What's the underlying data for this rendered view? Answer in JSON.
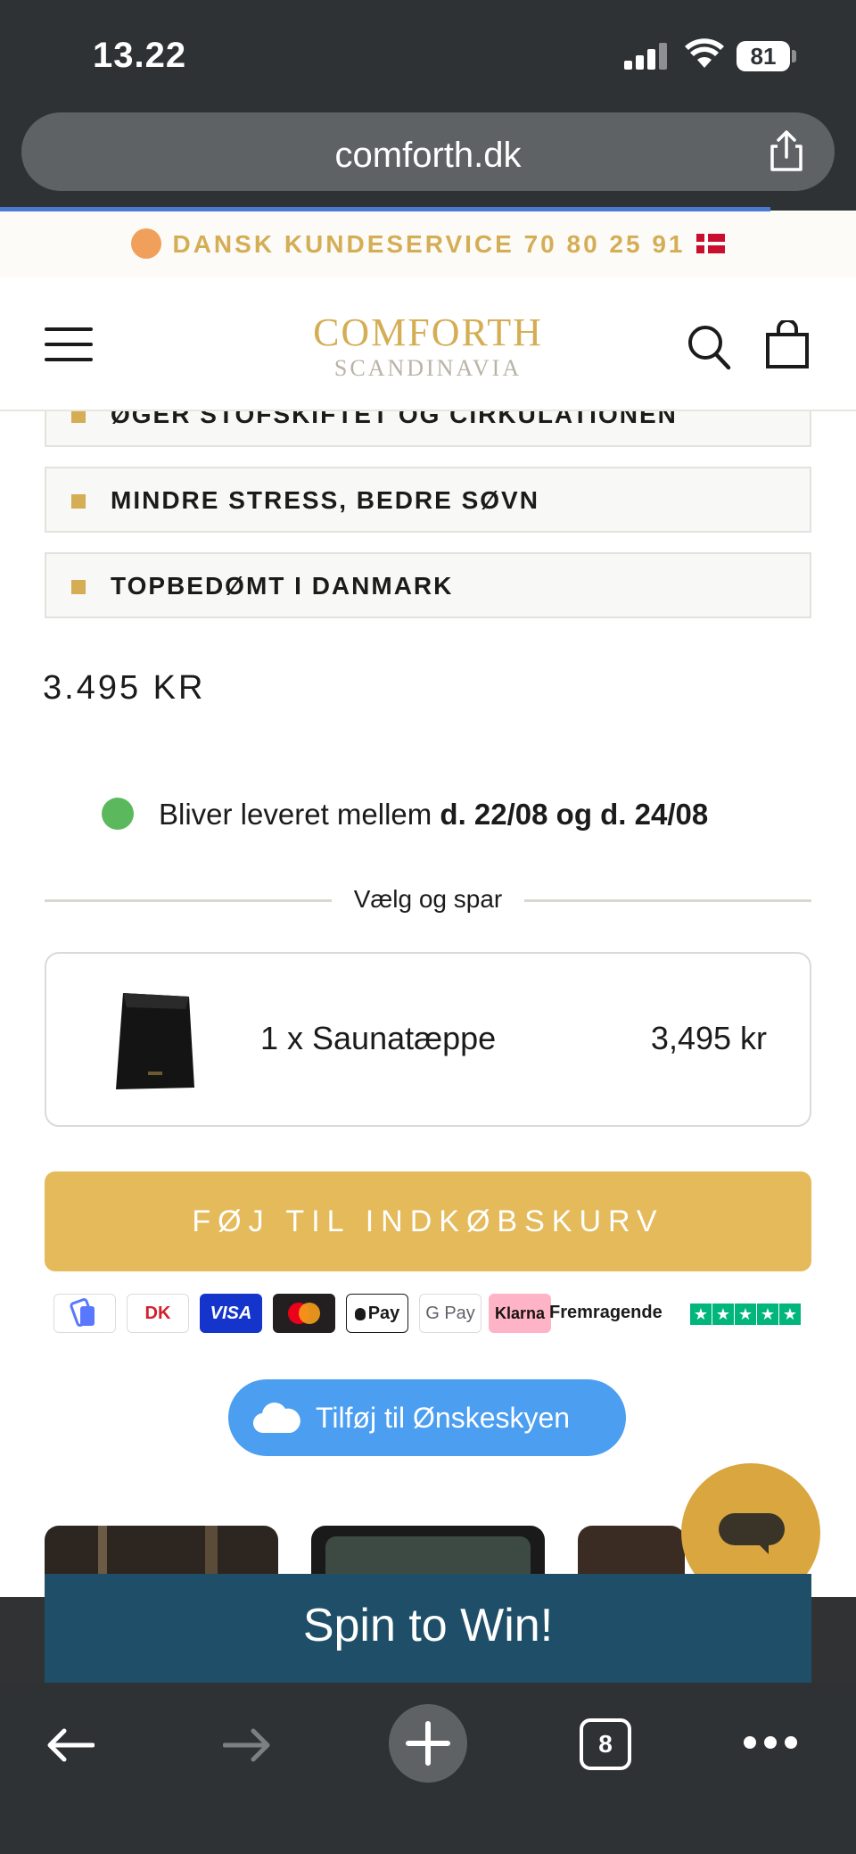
{
  "status_bar": {
    "time": "13.22",
    "battery": "81"
  },
  "browser": {
    "url": "comforth.dk",
    "tab_count": "8",
    "load_progress": 0.9
  },
  "announcement": {
    "text": "DANSK KUNDESERVICE 70 80 25 91"
  },
  "header": {
    "logo_main": "COMFORTH",
    "logo_sub": "SCANDINAVIA"
  },
  "benefits": [
    {
      "label": "ØGER STOFSKIFTET OG CIRKULATIONEN"
    },
    {
      "label": "MINDRE STRESS, BEDRE SØVN"
    },
    {
      "label": "TOPBEDØMT I DANMARK"
    }
  ],
  "product": {
    "price": "3.495 KR",
    "delivery_prefix": "Bliver leveret mellem ",
    "delivery_dates": "d. 22/08 og d. 24/08",
    "bundle_heading": "Vælg og spar",
    "bundle_item": "1 x Saunatæppe",
    "bundle_price": "3,495 kr",
    "add_to_cart": "FØJ TIL INDKØBSKURV",
    "wishlist": "Tilføj til Ønskeskyen"
  },
  "payments": [
    {
      "label": "MobilePay"
    },
    {
      "label": "DK"
    },
    {
      "label": "VISA"
    },
    {
      "label": "Mastercard"
    },
    {
      "label": "Pay"
    },
    {
      "label": "G Pay"
    },
    {
      "label": "Klarna"
    }
  ],
  "trustpilot": {
    "label": "Fremragende",
    "stars": 5
  },
  "popup": {
    "text": "Spin to Win!"
  },
  "colors": {
    "gold": "#d4ad55",
    "cart_button": "#e4ba5b",
    "wishlist": "#4b9ef0",
    "spin": "#1f4f68",
    "delivery_dot": "#5cb85c"
  },
  "icons": [
    "share-icon",
    "menu-icon",
    "search-icon",
    "bag-icon",
    "cloud-icon",
    "chat-icon",
    "back-icon",
    "forward-icon",
    "plus-icon",
    "more-icon"
  ]
}
